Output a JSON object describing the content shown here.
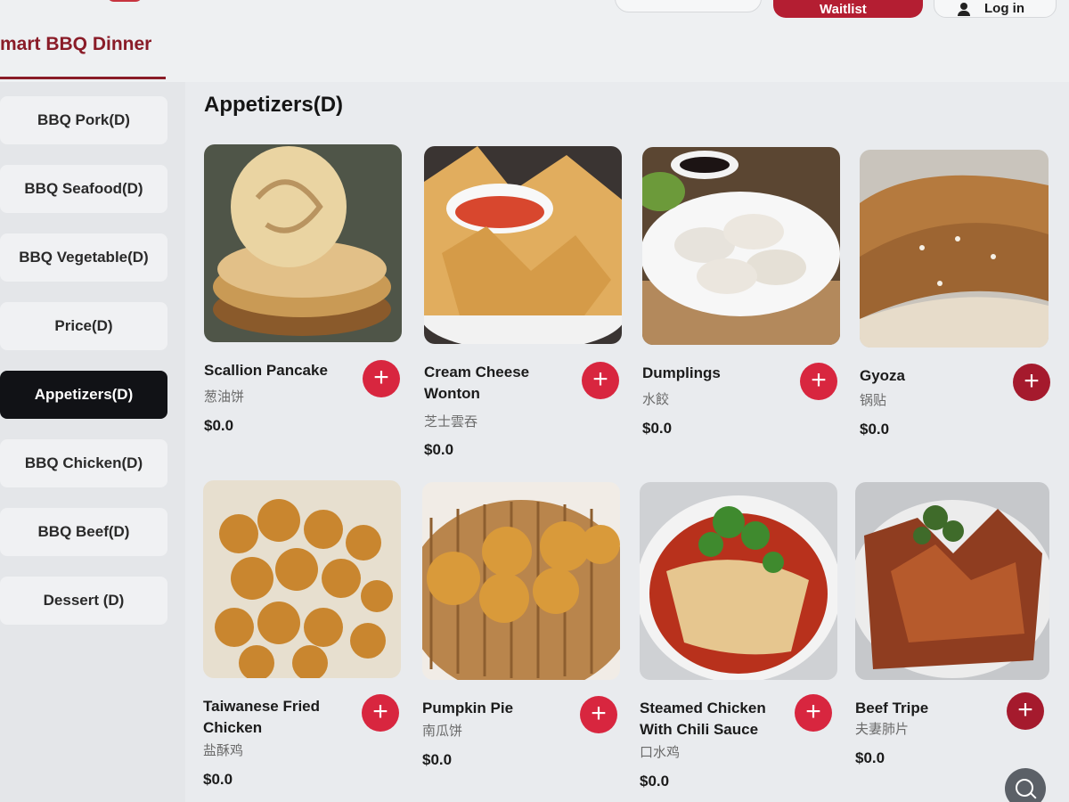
{
  "header": {
    "title": "mart BBQ Dinner",
    "waitlist_label": "Waitlist",
    "login_label": "Log in"
  },
  "sidebar": {
    "items": [
      {
        "label": "BBQ Pork(D)",
        "active": false
      },
      {
        "label": "BBQ Seafood(D)",
        "active": false
      },
      {
        "label": "BBQ Vegetable(D)",
        "active": false
      },
      {
        "label": "Price(D)",
        "active": false
      },
      {
        "label": "Appetizers(D)",
        "active": true
      },
      {
        "label": "BBQ Chicken(D)",
        "active": false
      },
      {
        "label": "BBQ Beef(D)",
        "active": false
      },
      {
        "label": "Dessert (D)",
        "active": false
      }
    ]
  },
  "main": {
    "section_title": "Appetizers(D)",
    "items": [
      {
        "name": "Scallion Pancake",
        "cn": "葱油饼",
        "price": "$0.0"
      },
      {
        "name": "Cream Cheese Wonton",
        "cn": "芝士雲吞",
        "price": "$0.0"
      },
      {
        "name": "Dumplings",
        "cn": "水餃",
        "price": "$0.0"
      },
      {
        "name": "Gyoza",
        "cn": "锅贴",
        "price": "$0.0"
      },
      {
        "name": "Taiwanese Fried Chicken",
        "cn": "盐酥鸡",
        "price": "$0.0"
      },
      {
        "name": "Pumpkin Pie",
        "cn": "南瓜饼",
        "price": "$0.0"
      },
      {
        "name": "Steamed Chicken With Chili Sauce",
        "cn": "口水鸡",
        "price": "$0.0"
      },
      {
        "name": "Beef Tripe",
        "cn": "夫妻肺片",
        "price": "$0.0"
      }
    ],
    "add_label": "+"
  },
  "colors": {
    "accent": "#d8263f",
    "title_red": "#8a1c28",
    "active_nav": "#111216"
  }
}
